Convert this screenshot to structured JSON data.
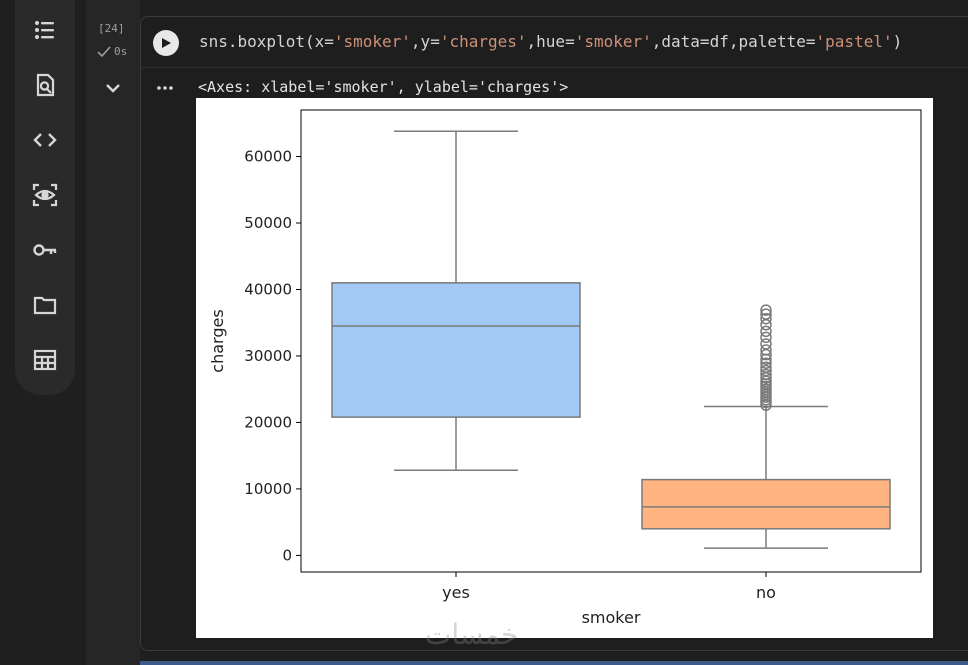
{
  "sidebar": {
    "items": [
      {
        "icon": "table-of-contents-icon"
      },
      {
        "icon": "find-replace-icon"
      },
      {
        "icon": "code-snippets-icon"
      },
      {
        "icon": "variables-inspector-icon"
      },
      {
        "icon": "secrets-key-icon"
      },
      {
        "icon": "files-folder-icon"
      },
      {
        "icon": "data-table-icon"
      }
    ]
  },
  "cell": {
    "execution_count": "[24]",
    "duration": "0s",
    "code_tokens": [
      {
        "t": "sns.boxplot(x=",
        "c": "fn"
      },
      {
        "t": "'smoker'",
        "c": "str"
      },
      {
        "t": ",y=",
        "c": "fn"
      },
      {
        "t": "'charges'",
        "c": "str"
      },
      {
        "t": ",hue=",
        "c": "fn"
      },
      {
        "t": "'smoker'",
        "c": "str"
      },
      {
        "t": ",data=df,palette=",
        "c": "fn"
      },
      {
        "t": "'pastel'",
        "c": "str"
      },
      {
        "t": ")",
        "c": "fn"
      }
    ],
    "output_text": "<Axes: xlabel='smoker', ylabel='charges'>"
  },
  "watermark": "خمسات",
  "colors": {
    "yes_box": "#a1c9f4",
    "no_box": "#ffb482",
    "line": "#7a7a7a"
  },
  "chart_data": {
    "type": "box",
    "title": "",
    "xlabel": "smoker",
    "ylabel": "charges",
    "categories": [
      "yes",
      "no"
    ],
    "ylim": [
      -2500,
      67000
    ],
    "yticks": [
      0,
      10000,
      20000,
      30000,
      40000,
      50000,
      60000
    ],
    "ytick_labels": [
      "0",
      "10000",
      "20000",
      "30000",
      "40000",
      "50000",
      "60000"
    ],
    "boxes": [
      {
        "category": "yes",
        "whisker_low": 12800,
        "q1": 20800,
        "median": 34500,
        "q3": 41000,
        "whisker_high": 63800,
        "outliers": []
      },
      {
        "category": "no",
        "whisker_low": 1100,
        "q1": 4000,
        "median": 7300,
        "q3": 11400,
        "whisker_high": 22400,
        "outliers": [
          22600,
          23000,
          23400,
          23800,
          24200,
          24600,
          25000,
          25400,
          25800,
          26200,
          26700,
          27200,
          27800,
          28300,
          28900,
          29500,
          30200,
          30900,
          31800,
          32800,
          33700,
          34700,
          35600,
          36300,
          36900
        ]
      }
    ],
    "grid": false,
    "legend": false
  }
}
